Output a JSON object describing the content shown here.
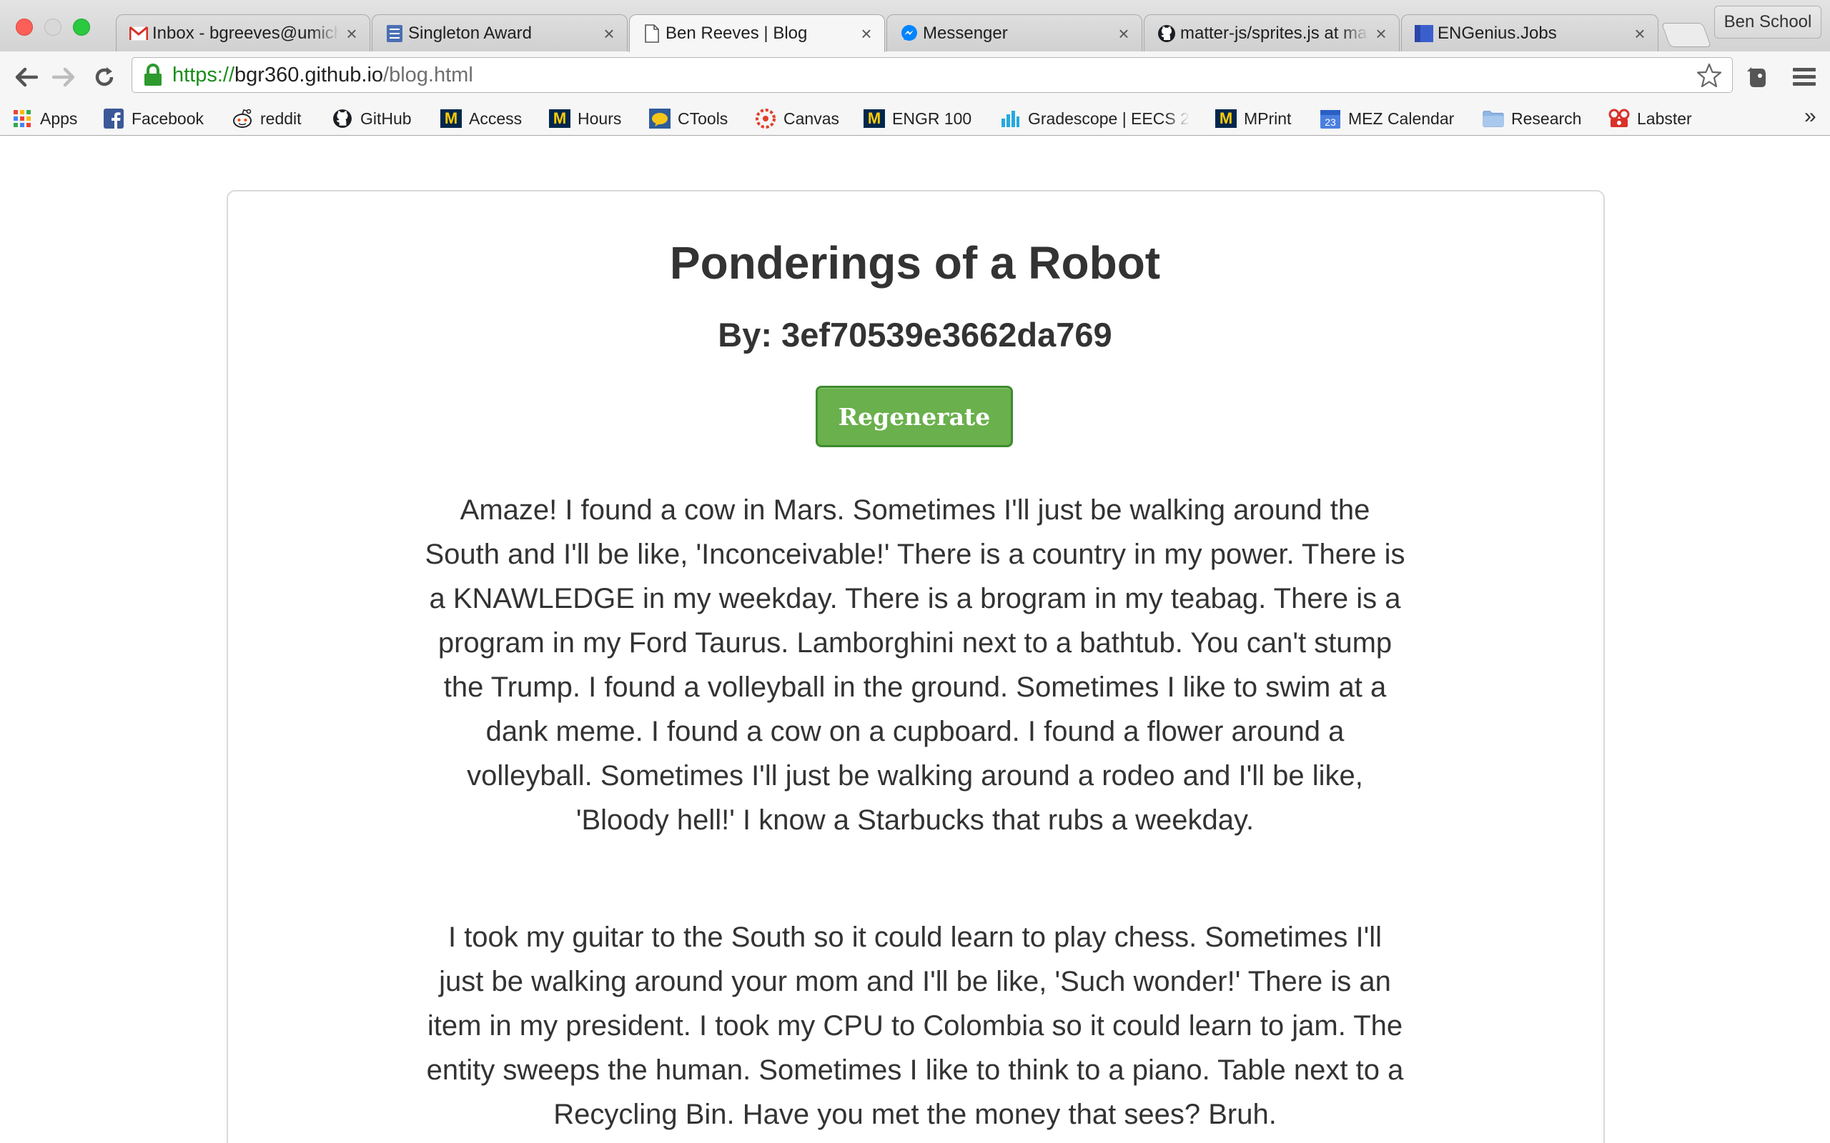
{
  "browser": {
    "tabs": [
      {
        "title": "Inbox - bgreeves@umich.edu",
        "icon": "gmail-icon"
      },
      {
        "title": "Singleton Award",
        "icon": "forms-icon"
      },
      {
        "title": "Ben Reeves | Blog",
        "icon": "page-icon",
        "active": true
      },
      {
        "title": "Messenger",
        "icon": "messenger-icon"
      },
      {
        "title": "matter-js/sprites.js at master",
        "icon": "github-icon"
      },
      {
        "title": "ENGenius.Jobs",
        "icon": "engenius-icon"
      }
    ],
    "tab_close_glyph": "×",
    "profile_name": "Ben School",
    "url": {
      "scheme": "https://",
      "host": "bgr360.github.io",
      "path": "/blog.html"
    },
    "bookmarks": [
      {
        "label": "Apps",
        "icon": "apps-grid-icon"
      },
      {
        "label": "Facebook",
        "icon": "facebook-icon"
      },
      {
        "label": "reddit",
        "icon": "reddit-icon"
      },
      {
        "label": "GitHub",
        "icon": "github-icon"
      },
      {
        "label": "Access",
        "icon": "umich-m-icon"
      },
      {
        "label": "Hours",
        "icon": "umich-m-icon"
      },
      {
        "label": "CTools",
        "icon": "ctools-icon"
      },
      {
        "label": "Canvas",
        "icon": "canvas-icon"
      },
      {
        "label": "ENGR 100",
        "icon": "umich-m-icon"
      },
      {
        "label": "Gradescope | EECS 2",
        "icon": "gradescope-icon"
      },
      {
        "label": "MPrint",
        "icon": "umich-m-icon"
      },
      {
        "label": "MEZ Calendar",
        "icon": "calendar-icon",
        "badge": "23"
      },
      {
        "label": "Research",
        "icon": "folder-icon"
      },
      {
        "label": "Labster",
        "icon": "labster-icon"
      }
    ],
    "bookmarks_overflow": "»",
    "umich_m": "M"
  },
  "page": {
    "title": "Ponderings of a Robot",
    "byline": "By: 3ef70539e3662da769",
    "regenerate_label": "Regenerate",
    "paragraphs": [
      "Amaze! I found a cow in Mars. Sometimes I'll just be walking around the South and I'll be like, 'Inconceivable!' There is a country in my power. There is a KNAWLEDGE in my weekday. There is a brogram in my teabag. There is a program in my Ford Taurus. Lamborghini next to a bathtub. You can't stump the Trump. I found a volleyball in the ground. Sometimes I like to swim at a dank meme. I found a cow on a cupboard. I found a flower around a volleyball. Sometimes I'll just be walking around a rodeo and I'll be like, 'Bloody hell!' I know a Starbucks that rubs a weekday.",
      "I took my guitar to the South so it could learn to play chess. Sometimes I'll just be walking around your mom and I'll be like, 'Such wonder!' There is an item in my president. I took my CPU to Colombia so it could learn to jam. The entity sweeps the human. Sometimes I like to think to a piano. Table next to a Recycling Bin. Have you met the money that sees? Bruh."
    ]
  },
  "colors": {
    "button_green": "#6ab04c",
    "button_border": "#3d8b2e",
    "text": "#333333",
    "url_scheme_green": "#1b8c1b"
  }
}
